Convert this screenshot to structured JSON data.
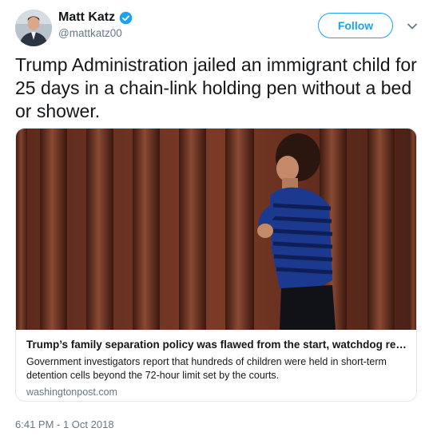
{
  "author": {
    "name": "Matt Katz",
    "handle": "@mattkatz00",
    "verified": true,
    "avatar_icon": "user-avatar"
  },
  "follow_label": "Follow",
  "tweet_text": "Trump Administration jailed an immigrant child for 25 days in a chain-link holding pen without a bed or shower.",
  "card": {
    "title": "Trump’s family separation policy was flawed from the start, watchdog review ...",
    "description": "Government investigators report that hundreds of children were held in short-term detention cells beyond the 72-hour limit set by the courts.",
    "domain": "washingtonpost.com"
  },
  "timestamp": "6:41 PM - 1 Oct 2018",
  "colors": {
    "accent": "#1da1f2",
    "text": "#14171a",
    "secondary": "#657786",
    "border": "#e1e8ed"
  }
}
